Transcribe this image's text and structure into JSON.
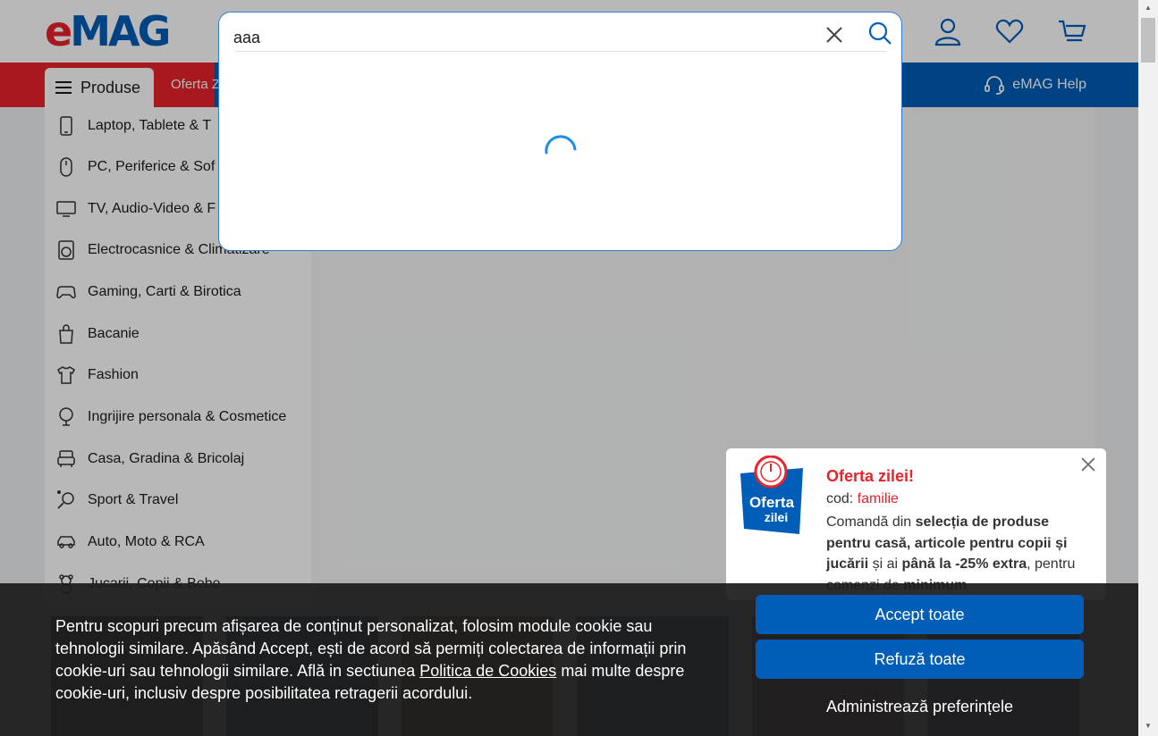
{
  "header": {
    "logo_e": "e",
    "logo_rest": "MAG",
    "produse_label": "Produse",
    "nav_link": "Oferta Z",
    "help_label": "eMAG Help"
  },
  "search": {
    "value": "aaa",
    "clear_icon": "close-icon",
    "search_icon": "search-icon"
  },
  "categories": [
    {
      "label": "Laptop, Tablete & T",
      "icon": "phone-icon"
    },
    {
      "label": "PC, Periferice & Sof",
      "icon": "mouse-icon"
    },
    {
      "label": "TV, Audio-Video & F",
      "icon": "tv-icon"
    },
    {
      "label": "Electrocasnice & Climatizare",
      "icon": "washing-machine-icon"
    },
    {
      "label": "Gaming, Carti & Birotica",
      "icon": "gamepad-icon"
    },
    {
      "label": "Bacanie",
      "icon": "shopping-bag-icon"
    },
    {
      "label": "Fashion",
      "icon": "tshirt-icon"
    },
    {
      "label": "Ingrijire personala & Cosmetice",
      "icon": "mirror-icon"
    },
    {
      "label": "Casa, Gradina & Bricolaj",
      "icon": "armchair-icon"
    },
    {
      "label": "Sport & Travel",
      "icon": "racket-icon"
    },
    {
      "label": "Auto, Moto & RCA",
      "icon": "car-icon"
    },
    {
      "label": "Jucarii, Copii & Bebe",
      "icon": "teddy-bear-icon"
    }
  ],
  "promo": {
    "badge_line1": "Oferta",
    "badge_line2": "zilei",
    "title": "Oferta zilei!",
    "code_label": "cod: ",
    "code_value": "familie",
    "desc_1": "Comandă din ",
    "desc_2": "selecția de produse pentru casă, articole pentru copii și jucării",
    "desc_3": " și ai ",
    "desc_4": "până la -25% extra",
    "desc_5": ", pentru comenzi de ",
    "desc_6": "minimum"
  },
  "cookie": {
    "text_1": "Pentru scopuri precum afișarea de conținut personalizat, folosim module cookie sau tehnologii similare. Apăsând Accept, ești de acord să permiți colectarea de informații prin cookie-uri sau tehnologii similare. Află in sectiunea ",
    "link": "Politica de Cookies",
    "text_2": " mai multe despre cookie-uri, inclusiv despre posibilitatea retragerii acordului.",
    "accept_label": "Accept toate",
    "refuse_label": "Refuză toate",
    "manage_label": "Administrează preferințele"
  },
  "colors": {
    "brand_red": "#e8232a",
    "brand_blue": "#005eb8",
    "search_border": "#2d7dd2"
  }
}
